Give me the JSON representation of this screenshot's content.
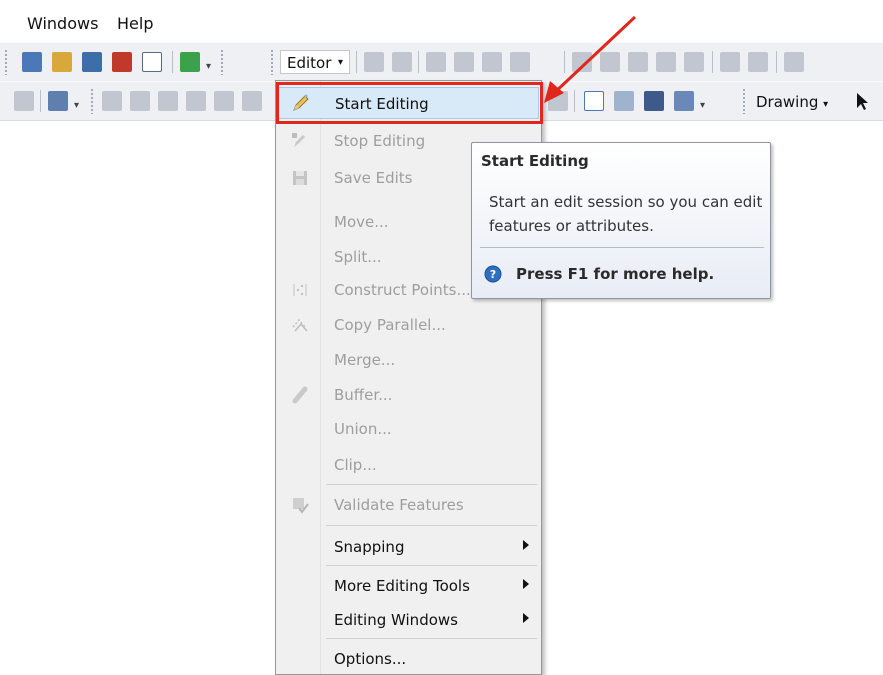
{
  "menubar": {
    "items": [
      {
        "label": "Windows"
      },
      {
        "label": "Help"
      }
    ]
  },
  "toolbar": {
    "editor_label": "Editor",
    "drawing_label": "Drawing"
  },
  "editor_menu": {
    "items": [
      {
        "label": "Start Editing",
        "enabled": true,
        "icon": "pencil-icon",
        "highlighted": true
      },
      {
        "label": "Stop Editing",
        "enabled": false,
        "icon": "stop-editing-icon"
      },
      {
        "label": "Save Edits",
        "enabled": false,
        "icon": "save-edits-icon"
      },
      {
        "label": "Move...",
        "enabled": false
      },
      {
        "label": "Split...",
        "enabled": false
      },
      {
        "label": "Construct Points...",
        "enabled": false,
        "icon": "construct-points-icon"
      },
      {
        "label": "Copy Parallel...",
        "enabled": false,
        "icon": "copy-parallel-icon"
      },
      {
        "label": "Merge...",
        "enabled": false
      },
      {
        "label": "Buffer...",
        "enabled": false,
        "icon": "buffer-icon"
      },
      {
        "label": "Union...",
        "enabled": false
      },
      {
        "label": "Clip...",
        "enabled": false
      },
      {
        "label": "Validate Features",
        "enabled": false,
        "icon": "validate-features-icon"
      },
      {
        "label": "Snapping",
        "enabled": true,
        "submenu": true
      },
      {
        "label": "More Editing Tools",
        "enabled": true,
        "submenu": true
      },
      {
        "label": "Editing Windows",
        "enabled": true,
        "submenu": true
      },
      {
        "label": "Options...",
        "enabled": true
      }
    ]
  },
  "tooltip": {
    "title": "Start Editing",
    "description": "Start an edit session so you can edit features or attributes.",
    "help": "Press F1 for more help."
  },
  "colors": {
    "highlight_box": "#e1261c",
    "arrow": "#e1261c",
    "menu_hover": "#d8e9f8"
  }
}
